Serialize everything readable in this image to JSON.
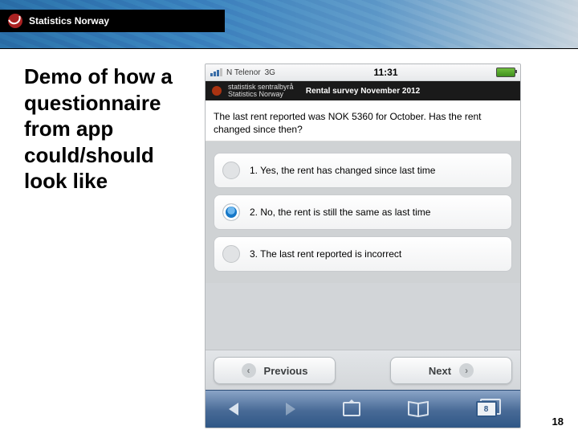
{
  "header": {
    "org_name": "Statistics Norway"
  },
  "slide": {
    "title": "Demo of how a questionnaire from app could/should look like",
    "page_number": "18"
  },
  "phone": {
    "status": {
      "carrier": "N Telenor",
      "network": "3G",
      "time": "11:31"
    },
    "app_header": {
      "org_small": "statistisk sentralbyrå\nStatistics Norway",
      "survey_title": "Rental survey November 2012"
    },
    "question": "The last rent reported was NOK 5360 for October. Has the rent changed since then?",
    "options": [
      {
        "label": "1.  Yes, the rent has changed since last time",
        "selected": false
      },
      {
        "label": "2.  No, the rent is still the same as last time",
        "selected": true
      },
      {
        "label": "3.  The last rent reported is incorrect",
        "selected": false
      }
    ],
    "nav": {
      "prev": "Previous",
      "next": "Next"
    },
    "toolbar": {
      "tab_count": "8"
    }
  }
}
